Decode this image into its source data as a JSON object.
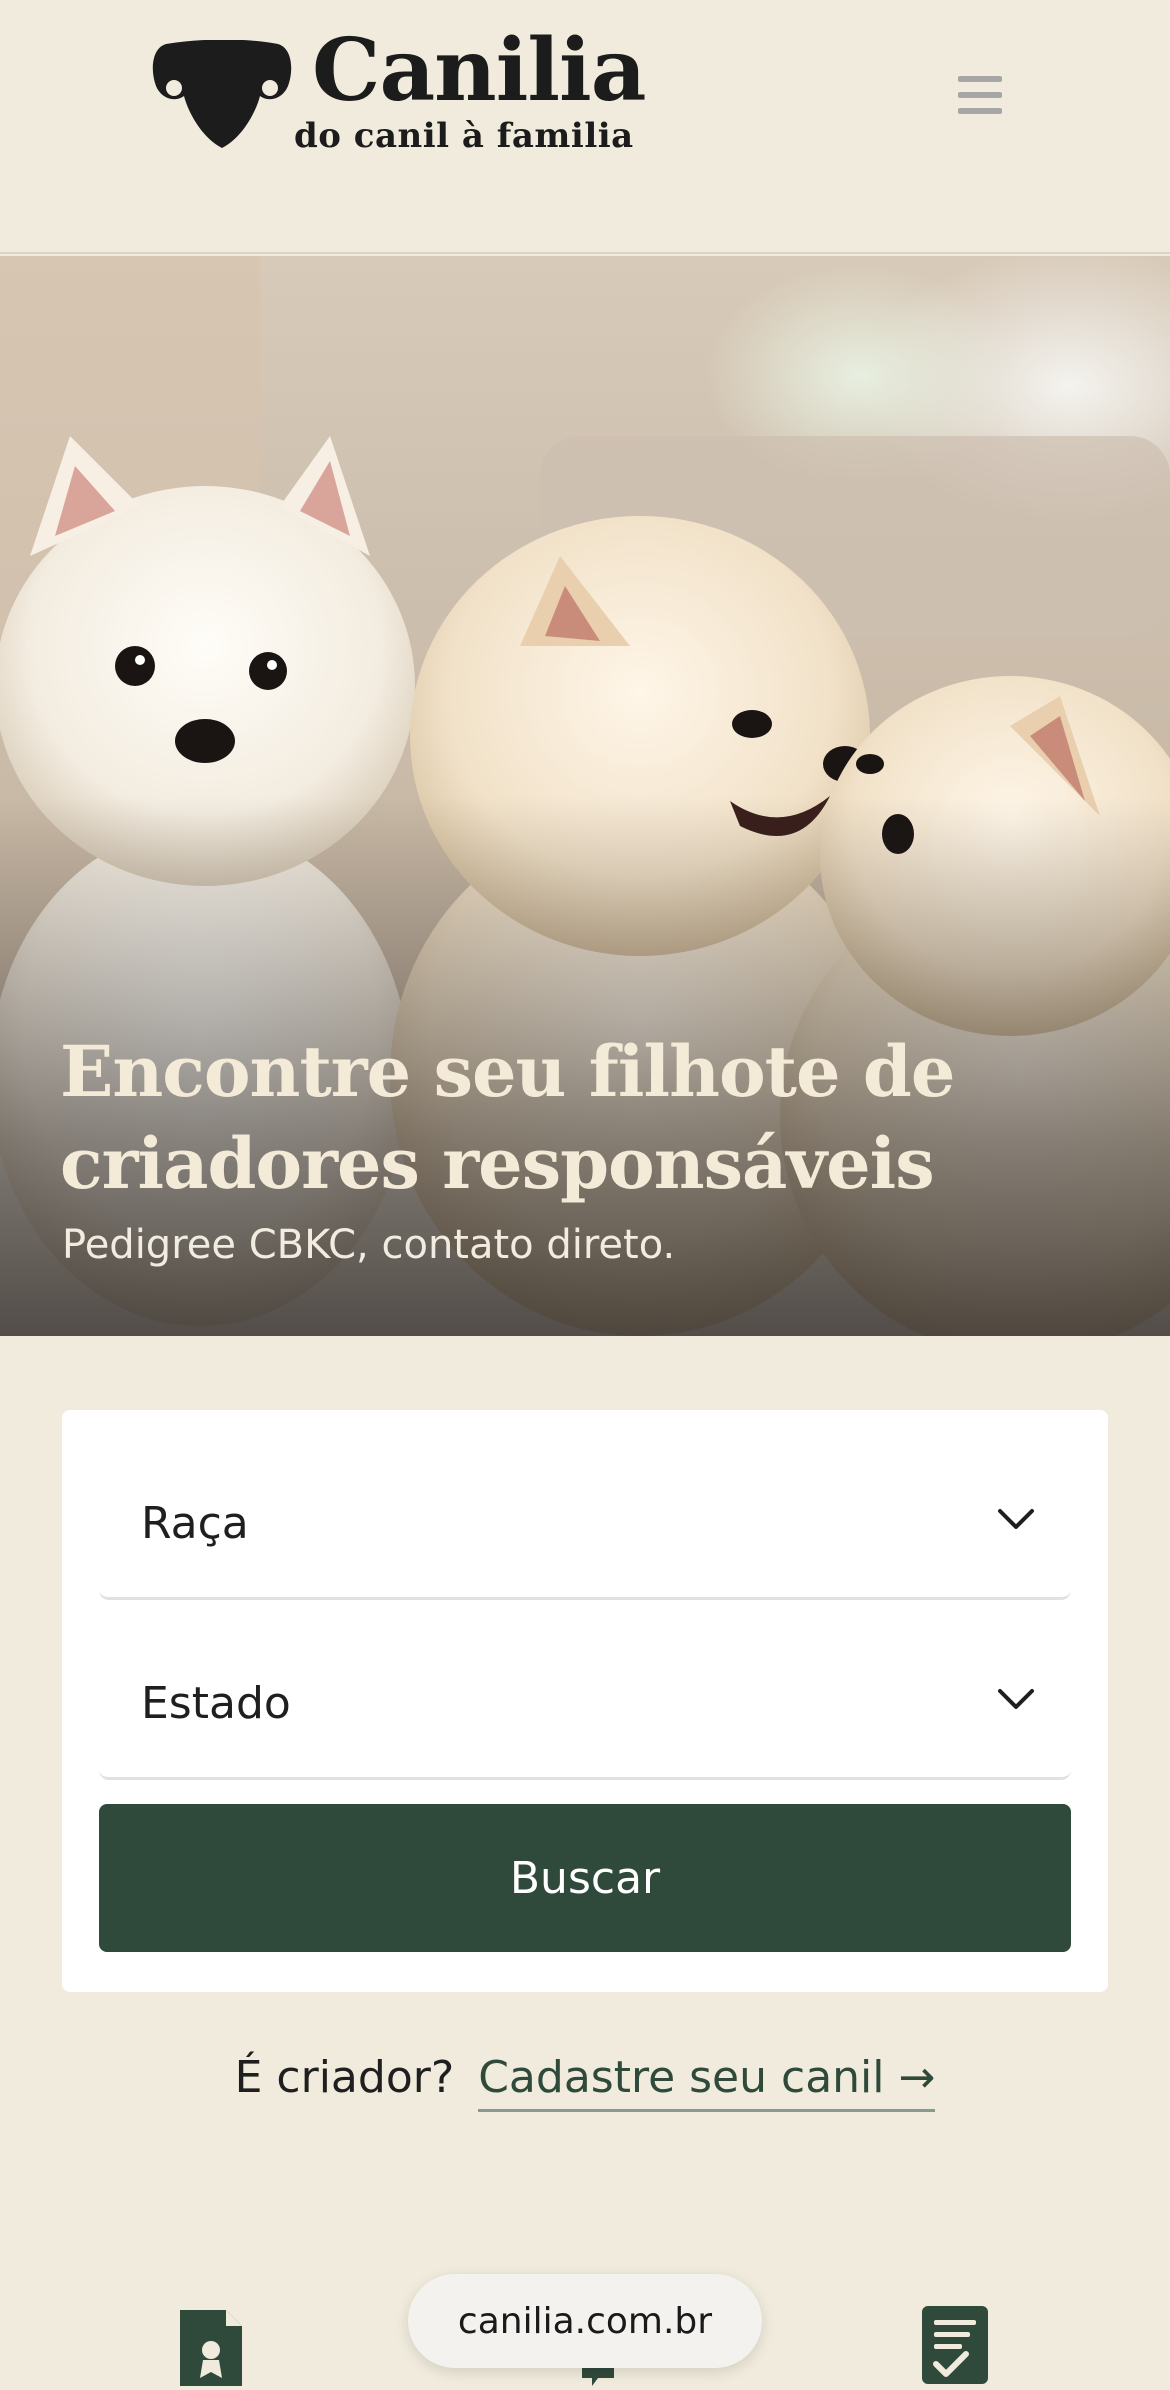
{
  "brand": {
    "name": "Canilia",
    "tagline": "do canil à familia"
  },
  "header": {
    "menu_icon": "hamburger-menu-icon"
  },
  "hero": {
    "title": "Encontre seu filhote de criadores responsáveis",
    "subtitle": "Pedigree CBKC, contato direto."
  },
  "search": {
    "breed_select": {
      "value": "Raça",
      "icon": "chevron-down-icon"
    },
    "state_select": {
      "value": "Estado",
      "icon": "chevron-down-icon"
    },
    "button_label": "Buscar"
  },
  "breeder_cta": {
    "question": "É criador?",
    "link_text": "Cadastre seu canil →"
  },
  "bottom_bar": {
    "url": "canilia.com.br",
    "icons": [
      "certificate-icon",
      "chat-icon",
      "checklist-icon"
    ]
  },
  "colors": {
    "background": "#f0ebdc",
    "primary_green": "#2f4a3b",
    "card": "#ffffff",
    "hero_text": "#f3ead7"
  }
}
